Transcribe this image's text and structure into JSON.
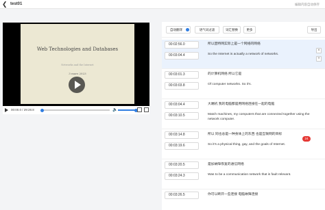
{
  "header": {
    "title": "test01",
    "saved_text": "编辑内容自动保存"
  },
  "video": {
    "slide_title": "Web Technologies and Databases",
    "slide_line_faint": "Networks and the Internet",
    "slide_date": "3 mars 2023",
    "time_display": "00:00.0 / 29:28.8",
    "progress_fraction": 0,
    "volume_fraction": 1
  },
  "toolbar": {
    "auto_translate": "自动翻译",
    "filler_filter": "语气词过滤",
    "replace_words": "词汇替换",
    "more": "更多",
    "export": "导出"
  },
  "segments": [
    {
      "start": "00:02:56.0",
      "end": "00:03:04.4",
      "zh": "所以因特网实际上是一个网络的网络",
      "en": "So the Internet is actually a network of networks."
    },
    {
      "start": "00:03:01.3",
      "end": "00:03:03.8",
      "zh": "的计算机网络 所以它是",
      "en": "Of computer networks. So it's."
    },
    {
      "start": "00:03:04.4",
      "end": "00:03:10.5",
      "zh": "大端机 我的电脑都是用网络连接在一起的电脑",
      "en": "Match machines, my computers that are connected together using the network computer."
    },
    {
      "start": "00:03:14.8",
      "end": "00:03:19.6",
      "zh": "所以 同也总是一种身体上的东西 也是互联网的目标",
      "en": "So it's a physical thing, gay, and the goals of Internet.",
      "badge": "24"
    },
    {
      "start": "00:03:20.5",
      "end": "00:03:24.3",
      "zh": "是加故障恢复的通信网络",
      "en": "Was to be a communication network that is fault relevant."
    },
    {
      "start": "00:03:26.5",
      "end": "",
      "zh": "你可以断开一些连接 电脑故障连接",
      "en": ""
    }
  ]
}
